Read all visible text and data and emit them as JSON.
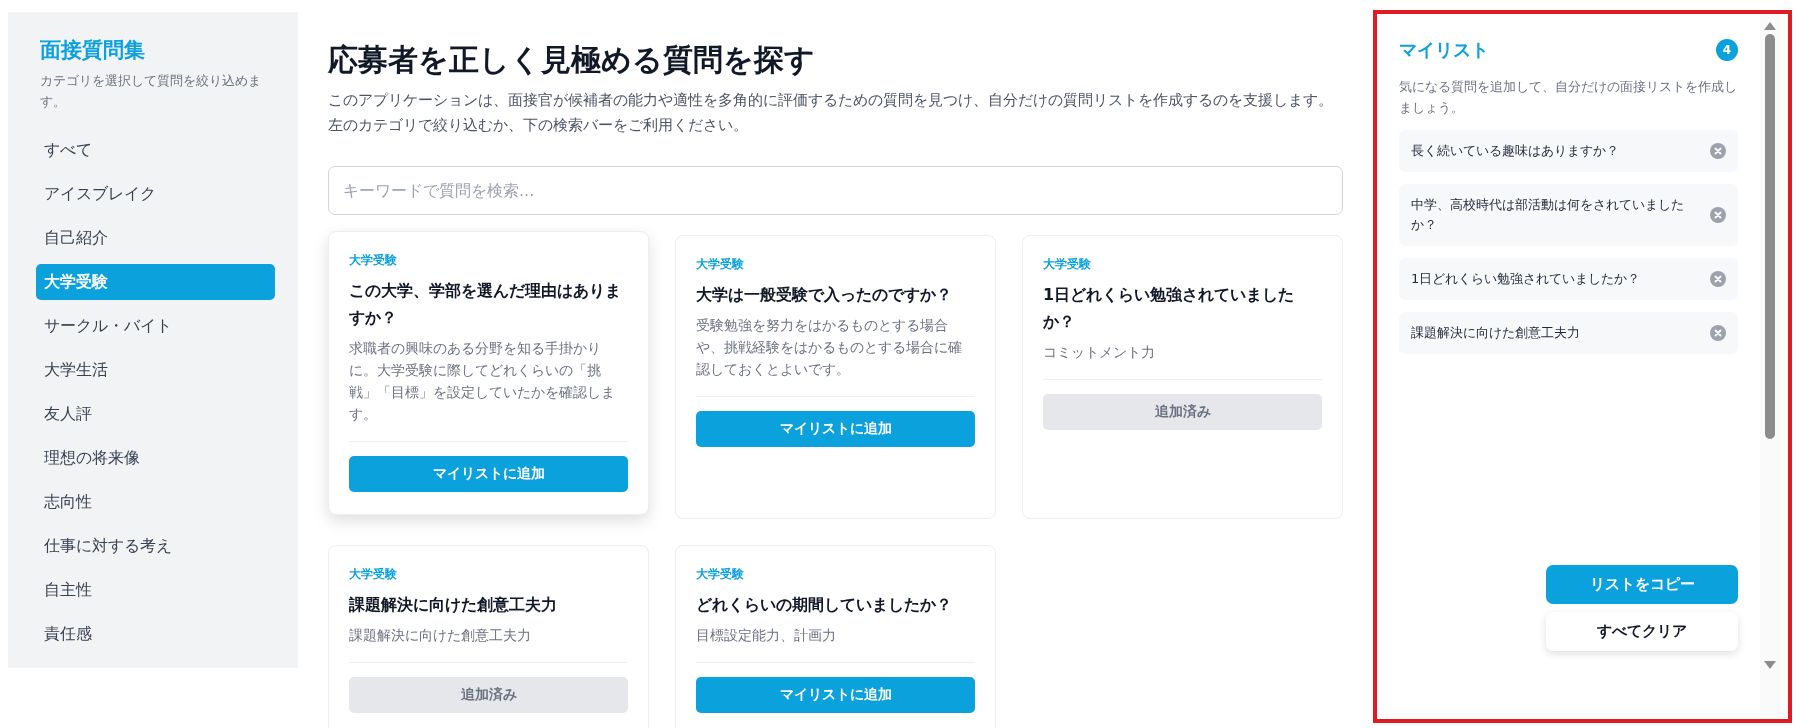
{
  "sidebar": {
    "title": "面接質問集",
    "subtitle": "カテゴリを選択して質問を絞り込めます。",
    "items": [
      {
        "label": "すべて",
        "selected": false
      },
      {
        "label": "アイスブレイク",
        "selected": false
      },
      {
        "label": "自己紹介",
        "selected": false
      },
      {
        "label": "大学受験",
        "selected": true
      },
      {
        "label": "サークル・バイト",
        "selected": false
      },
      {
        "label": "大学生活",
        "selected": false
      },
      {
        "label": "友人評",
        "selected": false
      },
      {
        "label": "理想の将来像",
        "selected": false
      },
      {
        "label": "志向性",
        "selected": false
      },
      {
        "label": "仕事に対する考え",
        "selected": false
      },
      {
        "label": "自主性",
        "selected": false
      },
      {
        "label": "責任感",
        "selected": false
      }
    ]
  },
  "main": {
    "title": "応募者を正しく見極める質問を探す",
    "description": "このアプリケーションは、面接官が候補者の能力や適性を多角的に評価するための質問を見つけ、自分だけの質問リストを作成するのを支援します。左のカテゴリで絞り込むか、下の検索バーをご利用ください。",
    "search": {
      "placeholder": "キーワードで質問を検索..."
    },
    "cards": [
      {
        "category": "大学受験",
        "title": "この大学、学部を選んだ理由はありますか？",
        "description": "求職者の興味のある分野を知る手掛かりに。大学受験に際してどれくらいの「挑戦」「目標」を設定していたかを確認します。",
        "button": "マイリストに追加",
        "added": false,
        "hovered": true
      },
      {
        "category": "大学受験",
        "title": "大学は一般受験で入ったのですか？",
        "description": "受験勉強を努力をはかるものとする場合や、挑戦経験をはかるものとする場合に確認しておくとよいです。",
        "button": "マイリストに追加",
        "added": false,
        "hovered": false
      },
      {
        "category": "大学受験",
        "title": "1日どれくらい勉強されていましたか？",
        "description": "コミットメント力",
        "button": "追加済み",
        "added": true,
        "hovered": false
      },
      {
        "category": "大学受験",
        "title": "課題解決に向けた創意工夫力",
        "description": "課題解決に向けた創意工夫力",
        "button": "追加済み",
        "added": true,
        "hovered": false
      },
      {
        "category": "大学受験",
        "title": "どれくらいの期間していましたか？",
        "description": "目標設定能力、計画力",
        "button": "マイリストに追加",
        "added": false,
        "hovered": false
      }
    ]
  },
  "my_list": {
    "title": "マイリスト",
    "count": "4",
    "description": "気になる質問を追加して、自分だけの面接リストを作成しましょう。",
    "items": [
      "長く続いている趣味はありますか？",
      "中学、高校時代は部活動は何をされていましたか？",
      "1日どれくらい勉強されていましたか？",
      "課題解決に向けた創意工夫力"
    ],
    "copy_button": "リストをコピー",
    "clear_button": "すべてクリア"
  }
}
